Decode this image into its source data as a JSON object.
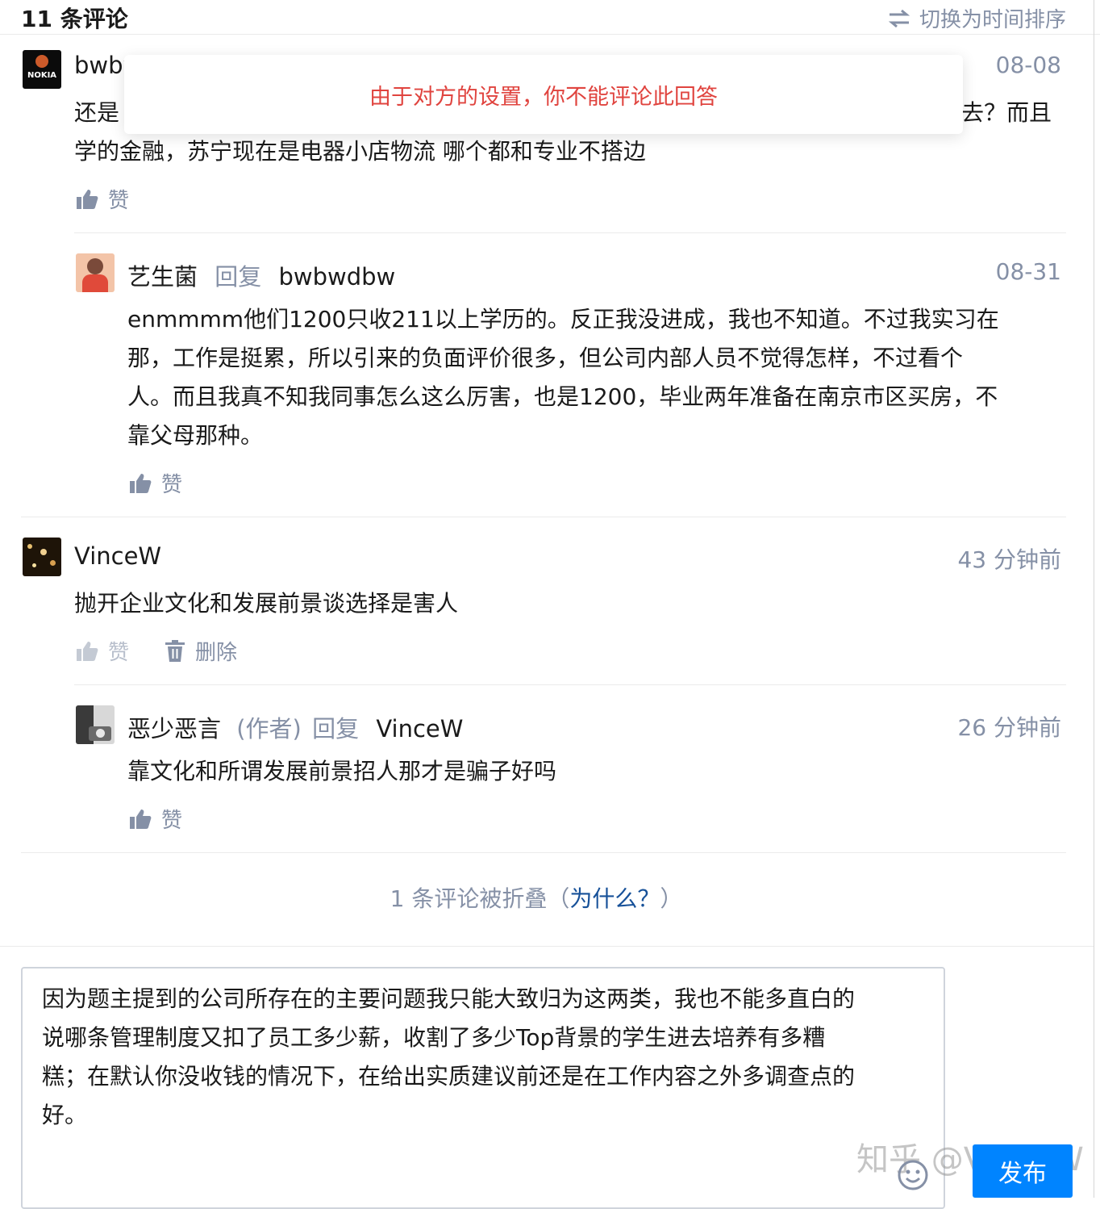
{
  "header": {
    "title": "11 条评论",
    "sort_label": "切换为时间排序"
  },
  "toast": {
    "message": "由于对方的设置，你不能评论此回答"
  },
  "comments": [
    {
      "author": "bwbw",
      "avatar_text": "NOKIA",
      "time": "08-08",
      "lines": [
        "还是",
        "学的金融，苏宁现在是电器小店物流 哪个都和专业不搭边"
      ],
      "line_tail": "去？而且",
      "like_label": "赞"
    },
    {
      "author": "艺生菌",
      "reply_label": "回复",
      "reply_to": "bwbwdbw",
      "time": "08-31",
      "lines": [
        "enmmmm他们1200只收211以上学历的。反正我没进成，我也不知道。不过我实习在",
        "那，工作是挺累，所以引来的负面评价很多，但公司内部人员不觉得怎样，不过看个",
        "人。而且我真不知我同事怎么这么厉害，也是1200，毕业两年准备在南京市区买房，不",
        "靠父母那种。"
      ],
      "like_label": "赞"
    },
    {
      "author": "VinceW",
      "time": "43 分钟前",
      "lines": [
        "抛开企业文化和发展前景谈选择是害人"
      ],
      "like_label": "赞",
      "delete_label": "删除"
    },
    {
      "author": "恶少恶言",
      "author_tag": "(作者)",
      "reply_label": "回复",
      "reply_to": "VinceW",
      "time": "26 分钟前",
      "lines": [
        "靠文化和所谓发展前景招人那才是骗子好吗"
      ],
      "like_label": "赞"
    }
  ],
  "collapsed": {
    "text": "1 条评论被折叠（",
    "link": "为什么？",
    "suffix": "）"
  },
  "composer": {
    "lines": [
      "因为题主提到的公司所存在的主要问题我只能大致归为这两类，我也不能多直白的",
      "说哪条管理制度又扣了员工多少薪，收割了多少Top背景的学生进去培养有多糟",
      "糕；在默认你没收钱的情况下，在给出实质建议前还是在工作内容之外多调查点的",
      "好。"
    ],
    "publish_label": "发布"
  },
  "watermark": "知乎 @VinceW",
  "colors": {
    "accent": "#0084ff",
    "link": "#175199",
    "meta": "#8590a6",
    "error": "#e0443f"
  }
}
